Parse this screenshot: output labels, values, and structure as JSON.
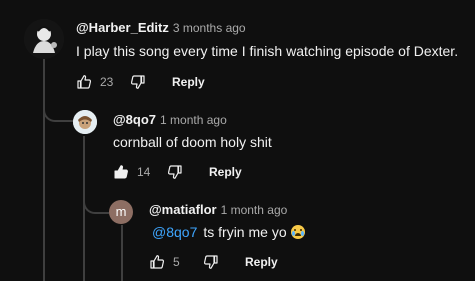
{
  "comments": [
    {
      "author": "@Harber_Editz",
      "time": "3 months ago",
      "text": "I play this song every time I finish watching episode of Dexter.",
      "likes": "23",
      "liked": false,
      "reply_label": "Reply"
    },
    {
      "author": "@8qo7",
      "time": "1 month ago",
      "text": "cornball of doom holy shit",
      "likes": "14",
      "liked": true,
      "reply_label": "Reply"
    },
    {
      "author": "@matiaflor",
      "time": "1 month ago",
      "mention": "@8qo7",
      "text": "ts fryin me yo",
      "emoji": "loudly-crying-face",
      "likes": "5",
      "liked": false,
      "reply_label": "Reply",
      "avatar_letter": "m"
    }
  ],
  "colors": {
    "background": "#0f0f0f",
    "text": "#f1f1f1",
    "secondary_text": "#aaaaaa",
    "mention": "#3ea6ff",
    "thread_line": "#3f3f3f",
    "avatar_m": "#8d6e63"
  }
}
